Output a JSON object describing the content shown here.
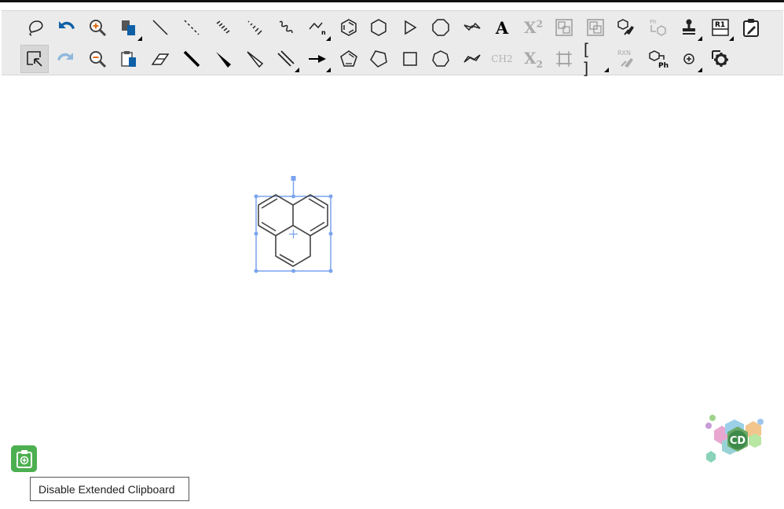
{
  "toolbar": {
    "row1": [
      {
        "name": "lasso-icon"
      },
      {
        "name": "undo-icon"
      },
      {
        "name": "zoom-in-icon"
      },
      {
        "name": "copy-icon"
      },
      {
        "name": "single-bond-icon"
      },
      {
        "name": "dashed-bond-icon"
      },
      {
        "name": "hashed-bond-icon"
      },
      {
        "name": "hashed-wedge-bond-icon"
      },
      {
        "name": "wavy-bond-icon"
      },
      {
        "name": "chain-icon"
      },
      {
        "name": "benzene-ring-icon"
      },
      {
        "name": "cyclohexane-ring-icon"
      },
      {
        "name": "cyclopropane-ring-icon"
      },
      {
        "name": "cyclooctane-ring-icon"
      },
      {
        "name": "chair-cyclohexane-icon"
      },
      {
        "name": "text-tool-icon",
        "label": "A"
      },
      {
        "name": "superscript-icon",
        "label": "X",
        "sup": "2"
      },
      {
        "name": "group-icon"
      },
      {
        "name": "ungroup-icon"
      },
      {
        "name": "clean-structure-icon"
      },
      {
        "name": "expand-label-icon",
        "label": "Ph"
      },
      {
        "name": "stamp-icon"
      },
      {
        "name": "r-group-icon",
        "label": "R1"
      },
      {
        "name": "clipboard-edit-icon"
      }
    ],
    "row2": [
      {
        "name": "select-icon"
      },
      {
        "name": "redo-icon"
      },
      {
        "name": "zoom-out-icon"
      },
      {
        "name": "paste-icon"
      },
      {
        "name": "eraser-icon"
      },
      {
        "name": "bold-bond-icon"
      },
      {
        "name": "wedge-bond-icon"
      },
      {
        "name": "hollow-wedge-bond-icon"
      },
      {
        "name": "double-bond-icon"
      },
      {
        "name": "arrow-icon"
      },
      {
        "name": "cyclopentadiene-ring-icon"
      },
      {
        "name": "cyclopentane-ring-icon"
      },
      {
        "name": "cyclobutane-ring-icon"
      },
      {
        "name": "cycloheptane-ring-icon"
      },
      {
        "name": "chair-cyclohexane-2-icon"
      },
      {
        "name": "ch2-label-icon",
        "label": "CH2"
      },
      {
        "name": "subscript-icon",
        "label": "X",
        "sub": "2"
      },
      {
        "name": "reaction-center-icon"
      },
      {
        "name": "brackets-icon",
        "label": "[ ]"
      },
      {
        "name": "clean-reaction-icon",
        "label": "RXN"
      },
      {
        "name": "contract-label-icon",
        "label": "Ph"
      },
      {
        "name": "charge-icon"
      },
      {
        "name": "settings-icon"
      }
    ]
  },
  "clipboard": {
    "tooltip": "Disable Extended Clipboard"
  },
  "logo": {
    "text": "CD"
  }
}
